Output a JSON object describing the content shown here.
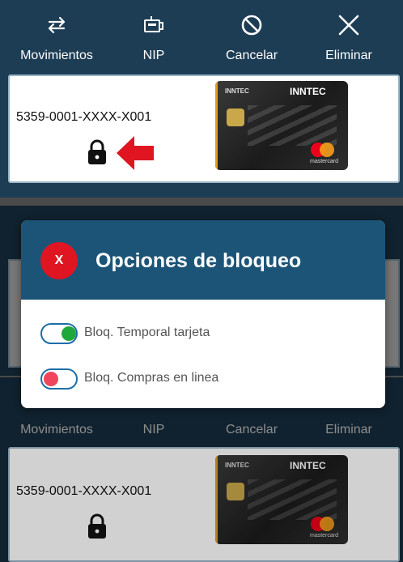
{
  "toolbar": {
    "items": [
      {
        "label": "Movimientos",
        "icon": "swap-arrows-icon"
      },
      {
        "label": "NIP",
        "icon": "card-reader-icon"
      },
      {
        "label": "Cancelar",
        "icon": "block-icon"
      },
      {
        "label": "Eliminar",
        "icon": "close-icon"
      }
    ]
  },
  "cards": [
    {
      "number": "5359-0001-XXXX-X001",
      "brand_left": "INNTEC",
      "brand_right": "INNTEC",
      "network": "mastercard",
      "locked": true
    },
    {
      "number": "5359-0001-XXXX-X001",
      "brand_left": "INNTEC",
      "brand_right": "INNTEC",
      "network": "mastercard",
      "locked": true
    }
  ],
  "modal": {
    "close_label": "X",
    "title": "Opciones de bloqueo",
    "options": [
      {
        "label": "Bloq. Temporal tarjeta",
        "enabled": true,
        "knob_color": "#1fa83a"
      },
      {
        "label": "Bloq. Compras en linea",
        "enabled": false,
        "knob_color": "#f0455a"
      }
    ]
  },
  "colors": {
    "header_blue": "#1d3d55",
    "modal_blue": "#1c5478",
    "accent_red": "#e01522"
  }
}
